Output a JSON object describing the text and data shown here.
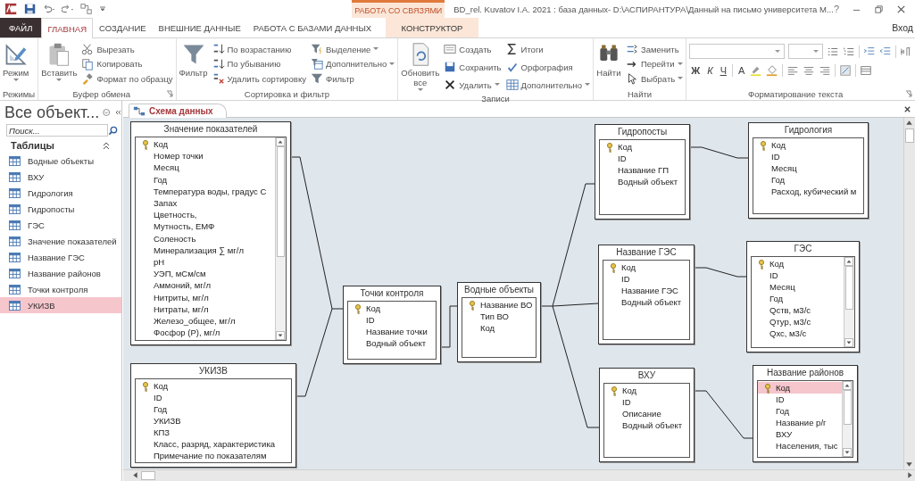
{
  "window": {
    "title": "BD_rel. Kuvatov I.A. 2021 : база данных- D:\\АСПИРАНТУРА\\Данный на письмо университета М...",
    "help": "?"
  },
  "context_group": "РАБОТА СО СВЯЗЯМИ",
  "tabs": [
    {
      "label": "ФАЙЛ",
      "kind": "file",
      "selected": false
    },
    {
      "label": "ГЛАВНАЯ",
      "kind": "tab",
      "selected": true
    },
    {
      "label": "СОЗДАНИЕ",
      "kind": "tab",
      "selected": false
    },
    {
      "label": "ВНЕШНИЕ ДАННЫЕ",
      "kind": "tab",
      "selected": false
    },
    {
      "label": "РАБОТА С БАЗАМИ ДАННЫХ",
      "kind": "tab",
      "selected": false
    },
    {
      "label": "КОНСТРУКТОР",
      "kind": "context",
      "selected": false
    }
  ],
  "sign_in": "Вход",
  "ribbon": {
    "groups": [
      {
        "label": "Режимы",
        "launcher": false,
        "columns": [
          {
            "kind": "large",
            "items": [
              {
                "label": "Режим",
                "dropdown": true
              }
            ]
          }
        ]
      },
      {
        "label": "Буфер обмена",
        "launcher": true,
        "columns": [
          {
            "kind": "large",
            "items": [
              {
                "label": "Вставить",
                "dropdown": true
              }
            ]
          },
          {
            "kind": "small",
            "items": [
              {
                "label": "Вырезать",
                "dropdown": false
              },
              {
                "label": "Копировать",
                "dropdown": false
              },
              {
                "label": "Формат по образцу",
                "dropdown": false
              }
            ]
          }
        ]
      },
      {
        "label": "Сортировка и фильтр",
        "launcher": false,
        "columns": [
          {
            "kind": "large",
            "items": [
              {
                "label": "Фильтр",
                "dropdown": false
              }
            ]
          },
          {
            "kind": "small",
            "items": [
              {
                "label": "По возрастанию",
                "dropdown": false
              },
              {
                "label": "По убыванию",
                "dropdown": false
              },
              {
                "label": "Удалить сортировку",
                "dropdown": false
              }
            ]
          },
          {
            "kind": "small",
            "items": [
              {
                "label": "Выделение",
                "dropdown": true
              },
              {
                "label": "Дополнительно",
                "dropdown": true
              },
              {
                "label": "Фильтр",
                "dropdown": false
              }
            ]
          }
        ]
      },
      {
        "label": "Записи",
        "launcher": false,
        "columns": [
          {
            "kind": "large",
            "items": [
              {
                "label": "Обновить все",
                "dropdown": true
              }
            ]
          },
          {
            "kind": "small",
            "items": [
              {
                "label": "Создать",
                "dropdown": false
              },
              {
                "label": "Сохранить",
                "dropdown": false
              },
              {
                "label": "Удалить",
                "dropdown": true
              }
            ]
          },
          {
            "kind": "small",
            "items": [
              {
                "label": "Итоги",
                "dropdown": false
              },
              {
                "label": "Орфография",
                "dropdown": false
              },
              {
                "label": "Дополнительно",
                "dropdown": true
              }
            ]
          }
        ]
      },
      {
        "label": "Найти",
        "launcher": false,
        "columns": [
          {
            "kind": "large",
            "items": [
              {
                "label": "Найти",
                "dropdown": false
              }
            ]
          },
          {
            "kind": "small",
            "items": [
              {
                "label": "Заменить",
                "dropdown": false
              },
              {
                "label": "Перейти",
                "dropdown": true
              },
              {
                "label": "Выбрать",
                "dropdown": true
              }
            ]
          }
        ]
      }
    ],
    "text_formatting": {
      "label": "Форматирование текста",
      "launcher": true,
      "style_buttons": [
        "Ж",
        "К",
        "Ч"
      ],
      "font_color": "А"
    }
  },
  "navigation_pane": {
    "title": "Все объект...",
    "search": {
      "placeholder": "Поиск..."
    },
    "section": "Таблицы",
    "items": [
      {
        "label": "Водные объекты",
        "selected": false
      },
      {
        "label": "ВХУ",
        "selected": false
      },
      {
        "label": "Гидрология",
        "selected": false
      },
      {
        "label": "Гидропосты",
        "selected": false
      },
      {
        "label": "ГЭС",
        "selected": false
      },
      {
        "label": "Значение показателей",
        "selected": false
      },
      {
        "label": "Название ГЭС",
        "selected": false
      },
      {
        "label": "Название районов",
        "selected": false
      },
      {
        "label": "Точки контроля",
        "selected": false
      },
      {
        "label": "УКИЗВ",
        "selected": true
      }
    ]
  },
  "document_tabs": [
    {
      "label": "Схема данных",
      "selected": true
    }
  ],
  "diagram": {
    "tables": [
      {
        "title": "Значение показателей",
        "scrollbar": true,
        "fields": [
          {
            "name": "Код",
            "key": true,
            "selected": false
          },
          {
            "name": "Номер точки",
            "key": false,
            "selected": false
          },
          {
            "name": "Месяц",
            "key": false,
            "selected": false
          },
          {
            "name": "Год",
            "key": false,
            "selected": false
          },
          {
            "name": "Температура воды, градус С",
            "key": false,
            "selected": false
          },
          {
            "name": "Запах",
            "key": false,
            "selected": false
          },
          {
            "name": "Цветность,",
            "key": false,
            "selected": false
          },
          {
            "name": "Мутность, ЕМФ",
            "key": false,
            "selected": false
          },
          {
            "name": "Соленость",
            "key": false,
            "selected": false
          },
          {
            "name": "Минерализация ∑ мг/л",
            "key": false,
            "selected": false
          },
          {
            "name": "pH",
            "key": false,
            "selected": false
          },
          {
            "name": "УЭП, мСм/см",
            "key": false,
            "selected": false
          },
          {
            "name": "Аммоний, мг/л",
            "key": false,
            "selected": false
          },
          {
            "name": "Нитриты, мг/л",
            "key": false,
            "selected": false
          },
          {
            "name": "Нитраты, мг/л",
            "key": false,
            "selected": false
          },
          {
            "name": "Железо_общее, мг/л",
            "key": false,
            "selected": false
          },
          {
            "name": "Фосфор (P), мг/л",
            "key": false,
            "selected": false
          }
        ]
      },
      {
        "title": "УКИЗВ",
        "scrollbar": false,
        "fields": [
          {
            "name": "Код",
            "key": true,
            "selected": false
          },
          {
            "name": "ID",
            "key": false,
            "selected": false
          },
          {
            "name": "Год",
            "key": false,
            "selected": false
          },
          {
            "name": "УКИЗВ",
            "key": false,
            "selected": false
          },
          {
            "name": "КПЗ",
            "key": false,
            "selected": false
          },
          {
            "name": "Класс, разряд, характеристика",
            "key": false,
            "selected": false
          },
          {
            "name": "Примечание по показателям",
            "key": false,
            "selected": false
          }
        ]
      },
      {
        "title": "Точки контроля",
        "scrollbar": false,
        "fields": [
          {
            "name": "Код",
            "key": true,
            "selected": false
          },
          {
            "name": "ID",
            "key": false,
            "selected": false
          },
          {
            "name": "Название точки",
            "key": false,
            "selected": false
          },
          {
            "name": "Водный объект",
            "key": false,
            "selected": false
          }
        ]
      },
      {
        "title": "Водные объекты",
        "scrollbar": false,
        "fields": [
          {
            "name": "Название ВО",
            "key": true,
            "selected": false
          },
          {
            "name": "Тип ВО",
            "key": false,
            "selected": false
          },
          {
            "name": "Код",
            "key": false,
            "selected": false
          }
        ]
      },
      {
        "title": "Гидропосты",
        "scrollbar": false,
        "fields": [
          {
            "name": "Код",
            "key": true,
            "selected": false
          },
          {
            "name": "ID",
            "key": false,
            "selected": false
          },
          {
            "name": "Название ГП",
            "key": false,
            "selected": false
          },
          {
            "name": "Водный объект",
            "key": false,
            "selected": false
          }
        ]
      },
      {
        "title": "Гидрология",
        "scrollbar": false,
        "fields": [
          {
            "name": "Код",
            "key": true,
            "selected": false
          },
          {
            "name": "ID",
            "key": false,
            "selected": false
          },
          {
            "name": "Месяц",
            "key": false,
            "selected": false
          },
          {
            "name": "Год",
            "key": false,
            "selected": false
          },
          {
            "name": "Расход, кубический  м",
            "key": false,
            "selected": false
          }
        ]
      },
      {
        "title": "Название ГЭС",
        "scrollbar": false,
        "fields": [
          {
            "name": "Код",
            "key": true,
            "selected": false
          },
          {
            "name": "ID",
            "key": false,
            "selected": false
          },
          {
            "name": "Название ГЭС",
            "key": false,
            "selected": false
          },
          {
            "name": "Водный объект",
            "key": false,
            "selected": false
          }
        ]
      },
      {
        "title": "ГЭС",
        "scrollbar": true,
        "fields": [
          {
            "name": "Код",
            "key": true,
            "selected": false
          },
          {
            "name": "ID",
            "key": false,
            "selected": false
          },
          {
            "name": "Месяц",
            "key": false,
            "selected": false
          },
          {
            "name": "Год",
            "key": false,
            "selected": false
          },
          {
            "name": "Qств, м3/с",
            "key": false,
            "selected": false
          },
          {
            "name": "Qтур, м3/с",
            "key": false,
            "selected": false
          },
          {
            "name": "Qхс, м3/с",
            "key": false,
            "selected": false
          }
        ]
      },
      {
        "title": "ВХУ",
        "scrollbar": false,
        "fields": [
          {
            "name": "Код",
            "key": true,
            "selected": false
          },
          {
            "name": "ID",
            "key": false,
            "selected": false
          },
          {
            "name": "Описание",
            "key": false,
            "selected": false
          },
          {
            "name": "Водный объект",
            "key": false,
            "selected": false
          }
        ]
      },
      {
        "title": "Название районов",
        "scrollbar": true,
        "fields": [
          {
            "name": "Код",
            "key": true,
            "selected": true
          },
          {
            "name": "ID",
            "key": false,
            "selected": false
          },
          {
            "name": "Год",
            "key": false,
            "selected": false
          },
          {
            "name": "Название р/г",
            "key": false,
            "selected": false
          },
          {
            "name": "ВХУ",
            "key": false,
            "selected": false
          },
          {
            "name": "Населения, тыс",
            "key": false,
            "selected": false
          }
        ]
      }
    ]
  }
}
